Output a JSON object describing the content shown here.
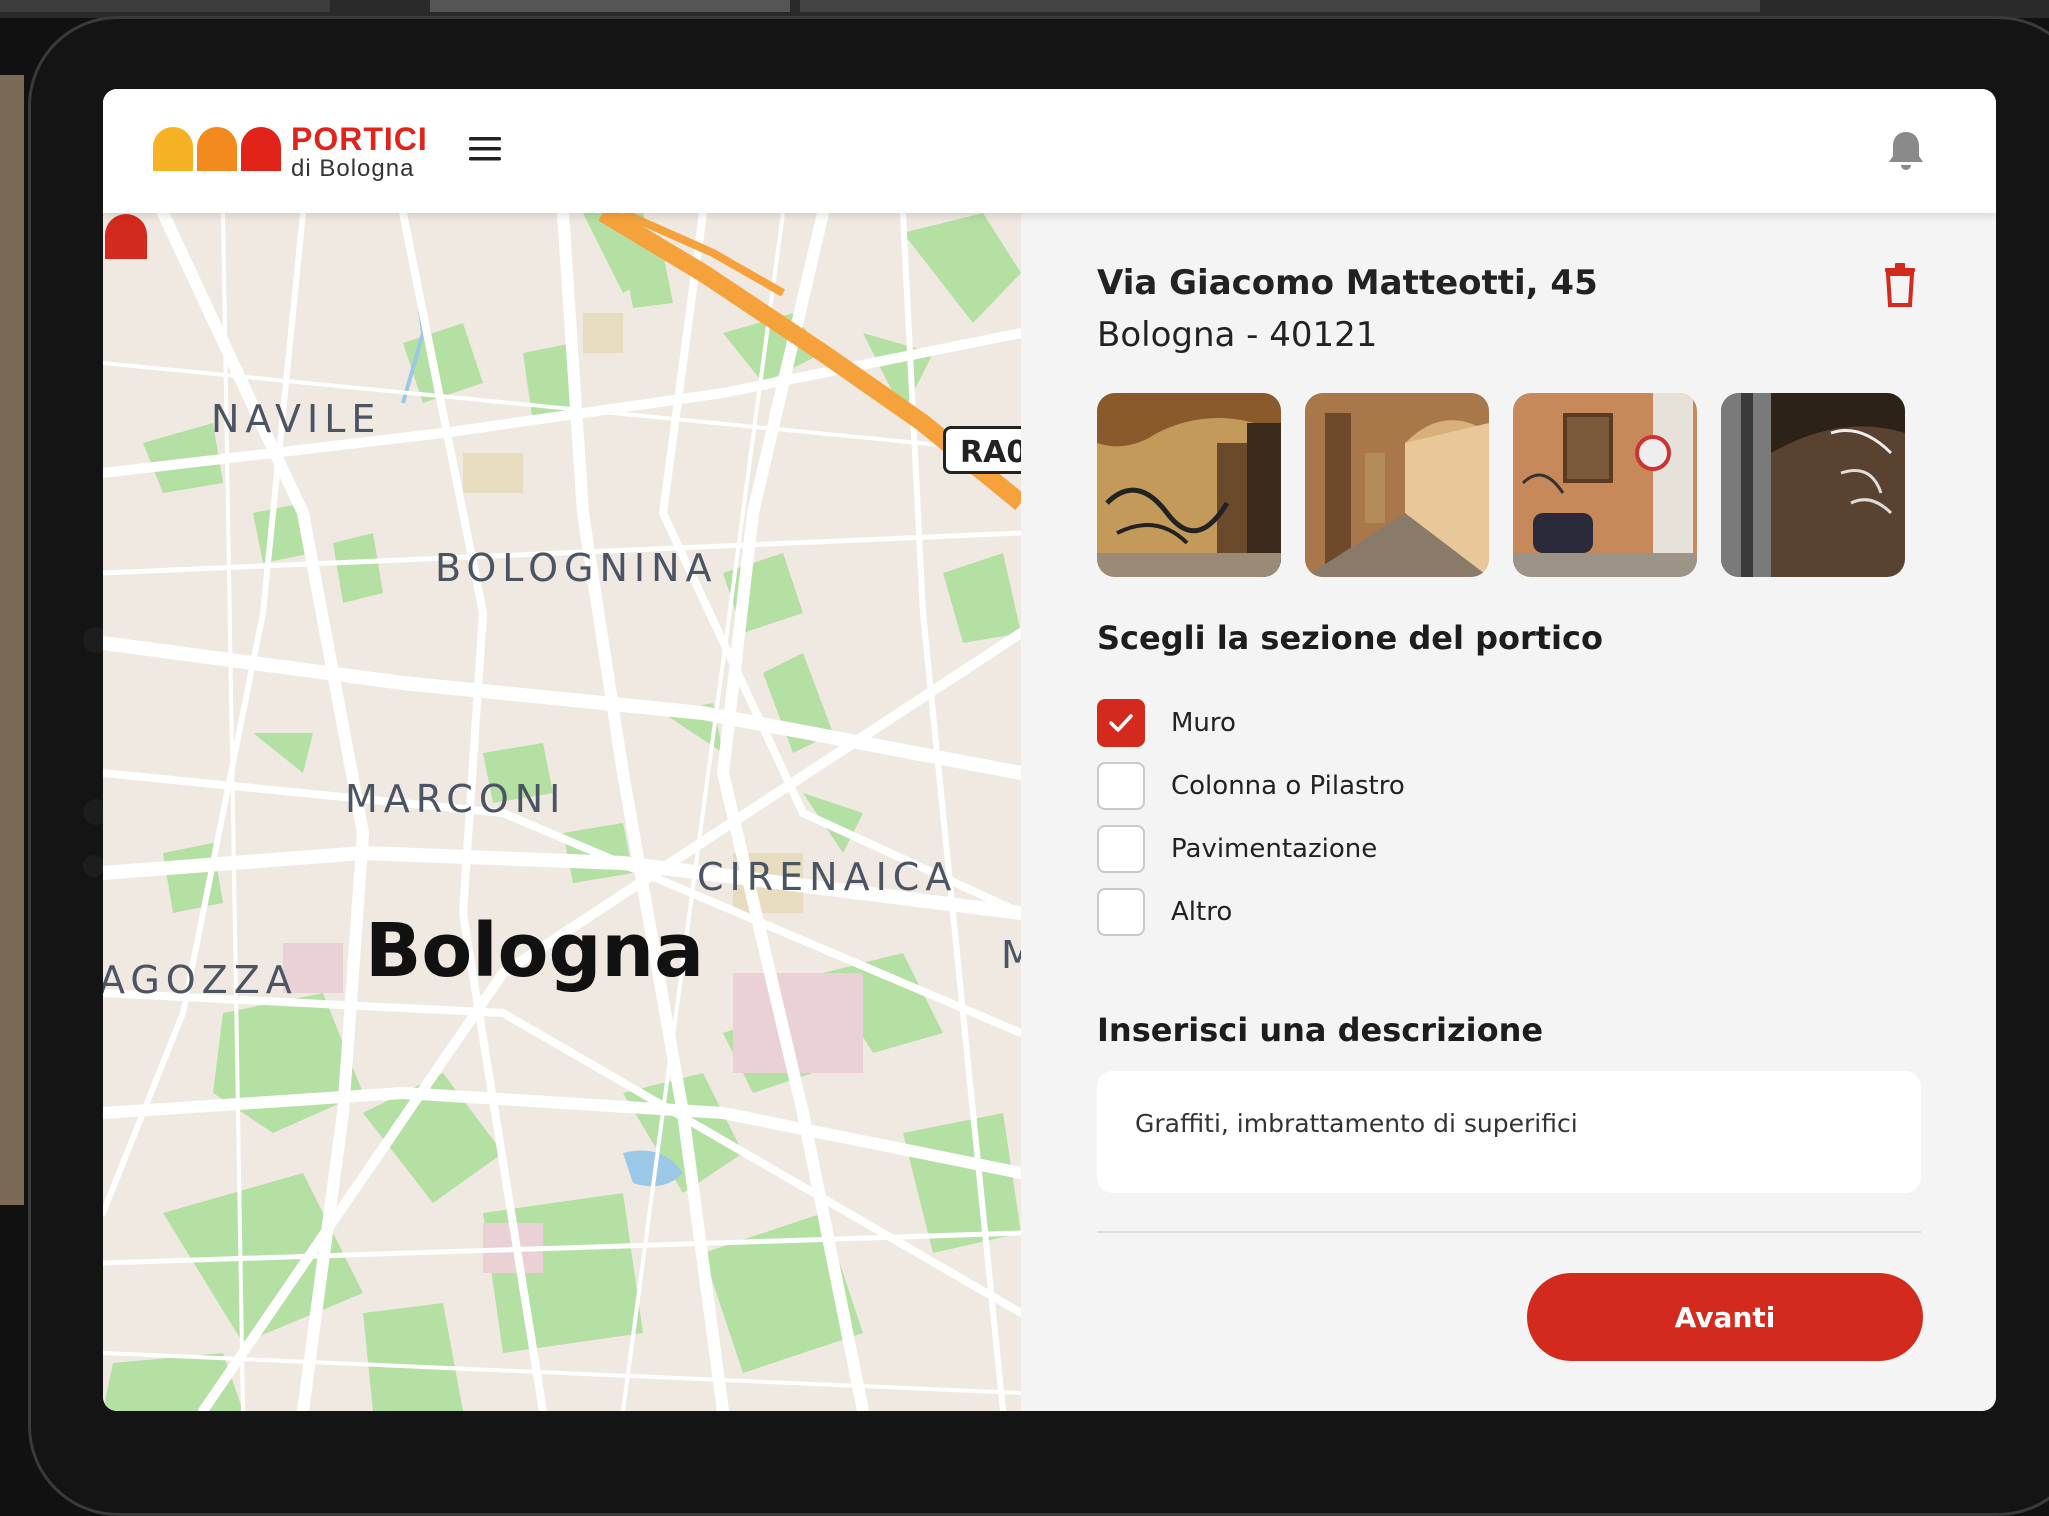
{
  "app": {
    "logo_title": "PORTICI",
    "logo_subtitle": "di Bologna",
    "brand_colors": [
      "#f5b324",
      "#f28a1e",
      "#e2231a"
    ]
  },
  "header": {
    "menu_icon": "hamburger-menu-icon",
    "bell_icon": "bell-icon"
  },
  "map": {
    "labels": {
      "navile": "NAVILE",
      "bolognina": "BOLOGNINA",
      "marconi": "MARCONI",
      "cirenaica": "CIRENAICA",
      "saragozza": "AGOZZA",
      "m_partial": "M"
    },
    "city": "Bologna",
    "road_badge": "RA0"
  },
  "panel": {
    "address_line1": "Via Giacomo Matteotti, 45",
    "address_line2": "Bologna - 40121",
    "delete_icon": "trash-icon",
    "section_title": "Scegli la sezione del portico",
    "options": [
      {
        "label": "Muro",
        "checked": true
      },
      {
        "label": "Colonna o Pilastro",
        "checked": false
      },
      {
        "label": "Pavimentazione",
        "checked": false
      },
      {
        "label": "Altro",
        "checked": false
      }
    ],
    "description_title": "Inserisci una descrizione",
    "description_value": "Graffiti, imbrattamento di superifici",
    "next_button": "Avanti",
    "accent_color": "#d42a1d"
  }
}
